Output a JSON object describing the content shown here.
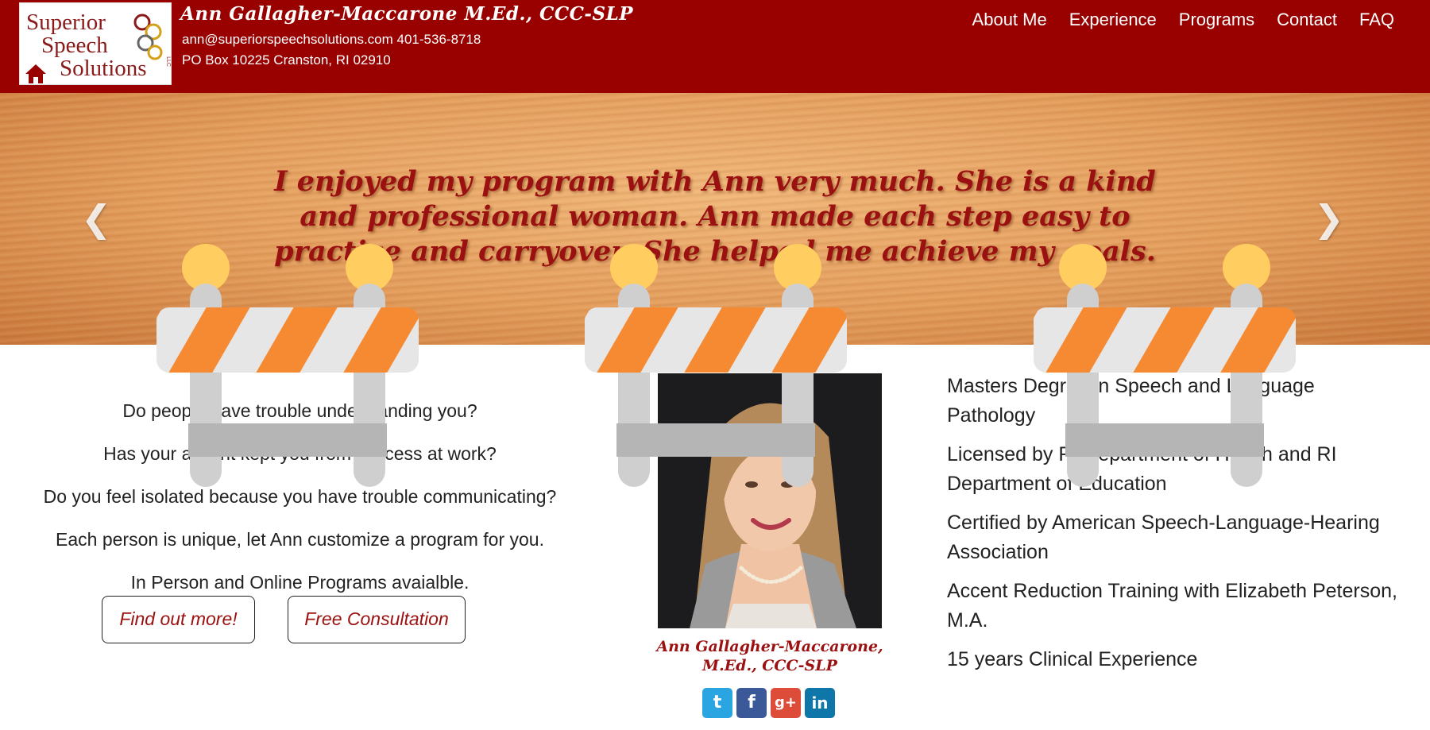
{
  "header": {
    "logo": {
      "line1": "Superior",
      "line2": "Speech",
      "line3": "Solutions",
      "llc": "LLC"
    },
    "name": "Ann Gallagher-Maccarone M.Ed., CCC-SLP",
    "contact": "ann@superiorspeechsolutions.com 401-536-8718",
    "address": "PO Box 10225 Cranston, RI 02910"
  },
  "nav": {
    "items": [
      "About Me",
      "Experience",
      "Programs",
      "Contact",
      "FAQ"
    ]
  },
  "hero": {
    "quote": "I enjoyed my program with Ann very much. She is a kind and professional woman. Ann made each step easy to practice and carryover. She helped me achieve my goals.",
    "prev_icon": "chevron-left-icon",
    "next_icon": "chevron-right-icon"
  },
  "intro": {
    "lines": [
      "Do people have trouble understanding you?",
      "Has your accent kept you from success at work?",
      "Do you feel isolated because you have trouble communicating?",
      "Each person is unique, let Ann customize a program for you.",
      "In Person and Online Programs avaialble."
    ],
    "find_out_label": "Find out more!",
    "free_consult_label": "Free Consultation"
  },
  "profile": {
    "caption_line1": "Ann Gallagher-Maccarone,",
    "caption_line2": "M.Ed., CCC-SLP",
    "social": {
      "twitter": "t",
      "facebook": "f",
      "googleplus": "g+",
      "linkedin": "in"
    }
  },
  "credentials": [
    "Masters Degree in Speech and Language Pathology",
    "Licensed by RI Department of Health and RI Department of Education",
    "Certified by American Speech-Language-Hearing Association",
    "Accent Reduction Training with Elizabeth Peterson, M.A.",
    "15 years Clinical Experience"
  ],
  "colors": {
    "brand_red": "#990000",
    "accent_text": "#9b1010",
    "barricade_orange": "#f68a33",
    "barricade_light": "#e6e6e6",
    "lamp_yellow": "#ffcd60"
  }
}
